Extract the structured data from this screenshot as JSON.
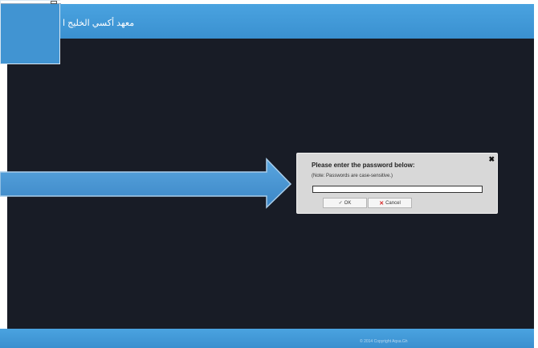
{
  "header": {
    "title": "معهد أكسي الخليج ا",
    "bg_color": "#4aa3e0"
  },
  "main": {
    "bg_color": "#181c26"
  },
  "dialog": {
    "title": "Please enter the password below:",
    "note": "(Note: Passwords are case-sensitive.)",
    "close_icon": "close-icon",
    "password_value": "",
    "ok_label": "OK",
    "ok_icon": "checkmark-icon",
    "cancel_label": "Cancel",
    "cancel_icon": "x-icon"
  },
  "footer": {
    "text": "© 2014 Copyright Aqsa.Gh"
  }
}
